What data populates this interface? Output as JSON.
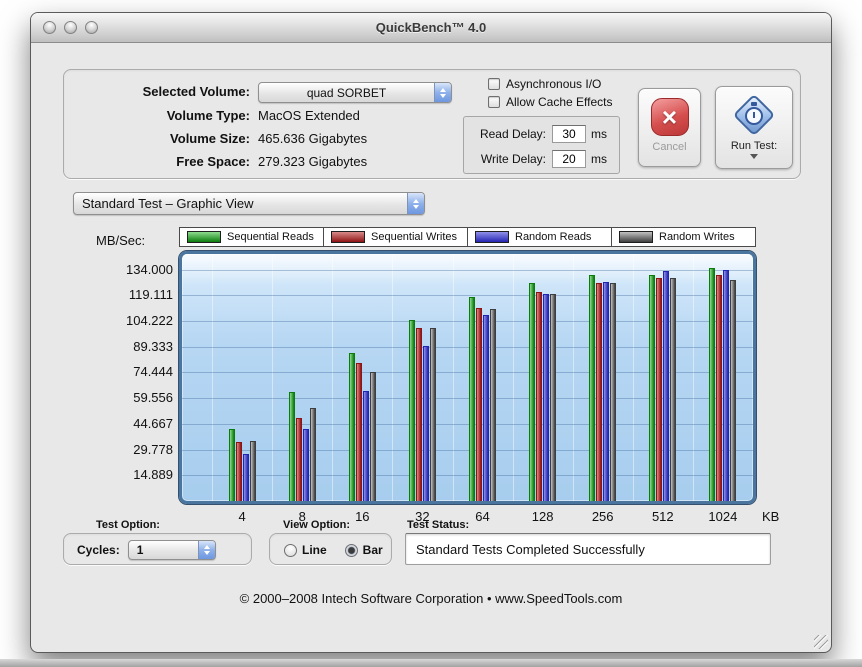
{
  "window": {
    "title": "QuickBench™ 4.0"
  },
  "volume_panel": {
    "selected_volume_label": "Selected Volume:",
    "selected_volume_value": "quad SORBET",
    "volume_type_label": "Volume Type:",
    "volume_type_value": "MacOS Extended",
    "volume_size_label": "Volume Size:",
    "volume_size_value": "465.636 Gigabytes",
    "free_space_label": "Free Space:",
    "free_space_value": "279.323 Gigabytes",
    "async_io_label": "Asynchronous I/O",
    "cache_effects_label": "Allow Cache Effects",
    "read_delay_label": "Read Delay:",
    "read_delay_value": "30",
    "write_delay_label": "Write Delay:",
    "write_delay_value": "20",
    "ms_label": "ms",
    "cancel_label": "Cancel",
    "run_test_label": "Run Test:"
  },
  "test_view_select": "Standard Test – Graphic View",
  "chart_data": {
    "type": "bar",
    "y_axis_unit": "MB/Sec:",
    "x_axis_unit": "KB",
    "categories": [
      "4",
      "8",
      "16",
      "32",
      "64",
      "128",
      "256",
      "512",
      "1024"
    ],
    "y_ticks": [
      "134.000",
      "119.111",
      "104.222",
      "89.333",
      "74.444",
      "59.556",
      "44.667",
      "29.778",
      "14.889"
    ],
    "ylim": [
      0,
      143
    ],
    "grid": true,
    "legend_position": "top",
    "series": [
      {
        "name": "Sequential Reads",
        "color_light": "#8fdc8f",
        "color_dark": "#0b7c0b",
        "values": [
          42,
          63,
          86,
          105,
          118,
          126,
          131,
          131,
          135
        ]
      },
      {
        "name": "Sequential Writes",
        "color_light": "#d98a8a",
        "color_dark": "#8e1313",
        "values": [
          34,
          48,
          80,
          100,
          112,
          121,
          126,
          129,
          131
        ]
      },
      {
        "name": "Random Reads",
        "color_light": "#9090ea",
        "color_dark": "#2424b2",
        "values": [
          27,
          42,
          64,
          90,
          108,
          120,
          127,
          133,
          134
        ]
      },
      {
        "name": "Random Writes",
        "color_light": "#c2c2c2",
        "color_dark": "#3e3e3e",
        "values": [
          35,
          54,
          75,
          100,
          111,
          120,
          126,
          129,
          128
        ]
      }
    ]
  },
  "bottom": {
    "test_option_label": "Test Option:",
    "cycles_label": "Cycles:",
    "cycles_value": "1",
    "view_option_label": "View Option:",
    "line_label": "Line",
    "bar_label": "Bar",
    "selected_view": "Bar",
    "test_status_label": "Test Status:",
    "test_status_value": "Standard Tests Completed Successfully"
  },
  "footer": "© 2000–2008 Intech Software Corporation • www.SpeedTools.com"
}
